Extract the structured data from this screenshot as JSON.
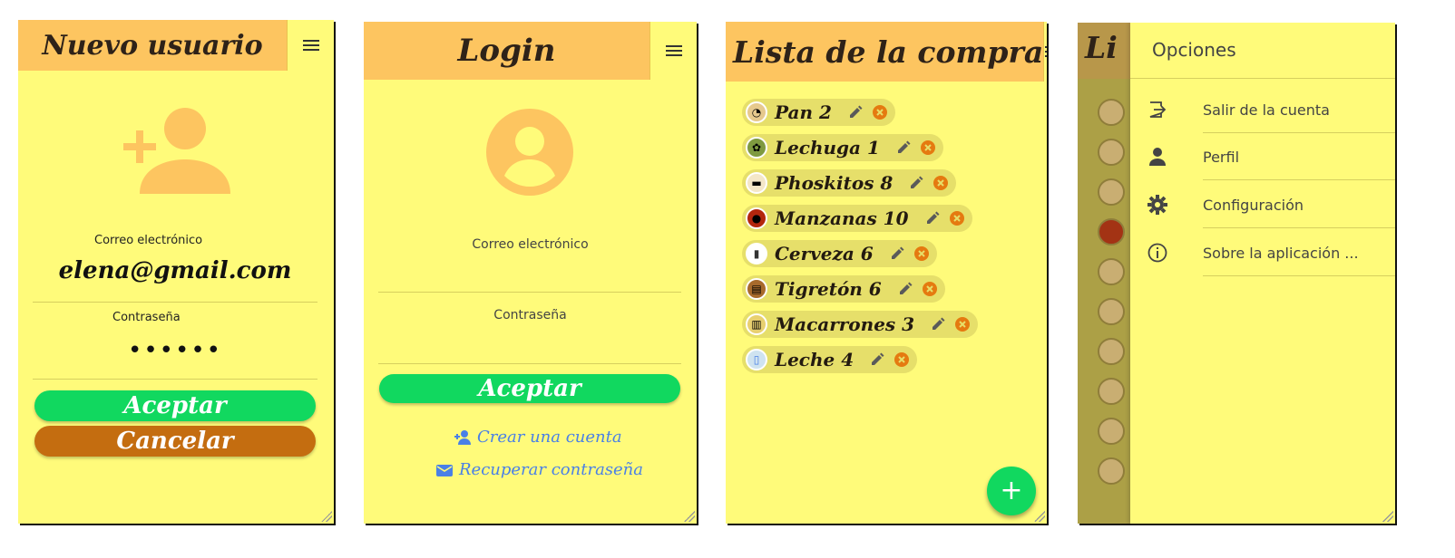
{
  "register": {
    "title": "Nuevo usuario",
    "email_label": "Correo electrónico",
    "email_value": "elena@gmail.com",
    "password_label": "Contraseña",
    "password_value": "••••••",
    "accept_label": "Aceptar",
    "cancel_label": "Cancelar"
  },
  "login": {
    "title": "Login",
    "email_label": "Correo electrónico",
    "password_label": "Contraseña",
    "accept_label": "Aceptar",
    "create_account_label": "Crear una cuenta",
    "recover_password_label": "Recuperar contraseña"
  },
  "shopping_list": {
    "title": "Lista de la compra",
    "items": [
      {
        "label": "Pan 2",
        "icon": "bread-icon"
      },
      {
        "label": "Lechuga 1",
        "icon": "lettuce-icon"
      },
      {
        "label": "Phoskitos 8",
        "icon": "cake-icon"
      },
      {
        "label": "Manzanas 10",
        "icon": "apple-icon"
      },
      {
        "label": "Cerveza 6",
        "icon": "beer-icon"
      },
      {
        "label": "Tigretón 6",
        "icon": "cake-icon"
      },
      {
        "label": "Macarrones 3",
        "icon": "pasta-icon"
      },
      {
        "label": "Leche 4",
        "icon": "milk-icon"
      }
    ]
  },
  "drawer": {
    "background_title": "Li",
    "header": "Opciones",
    "items": [
      {
        "label": "Salir de la cuenta",
        "icon": "logout-icon"
      },
      {
        "label": "Perfil",
        "icon": "person-icon"
      },
      {
        "label": "Configuración",
        "icon": "gear-icon"
      },
      {
        "label": "Sobre la aplicación ...",
        "icon": "info-icon"
      }
    ]
  },
  "colors": {
    "background": "#fffb7a",
    "header": "#fdc560",
    "accept": "#11d85f",
    "cancel": "#c46d10",
    "link": "#4a80e6",
    "delete": "#e57a10"
  }
}
